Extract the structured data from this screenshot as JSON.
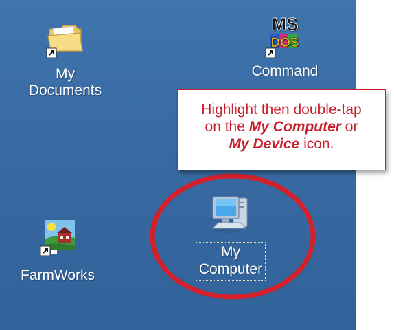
{
  "desktop": {
    "background_color": "#3a6ea5",
    "icons": [
      {
        "id": "my-documents",
        "label_line1": "My",
        "label_line2": "Documents",
        "icon": "folder-shortcut-icon"
      },
      {
        "id": "command",
        "label": "Command",
        "icon": "msdos-shortcut-icon",
        "icon_text_top": "MS",
        "icon_text_bottom": "DOS"
      },
      {
        "id": "farmworks",
        "label": "FarmWorks",
        "icon": "farmworks-shortcut-icon"
      },
      {
        "id": "my-computer",
        "label_line1": "My",
        "label_line2": "Computer",
        "icon": "computer-icon",
        "selected": true
      }
    ]
  },
  "callout": {
    "line1": "Highlight then double-tap",
    "line2_prefix": "on the ",
    "line2_emphasis": "My Computer",
    "line2_suffix": " or",
    "line3_emphasis": "My Device",
    "line3_suffix": " icon.",
    "color": "#c8202c"
  },
  "highlight": {
    "color": "#d4202a"
  }
}
